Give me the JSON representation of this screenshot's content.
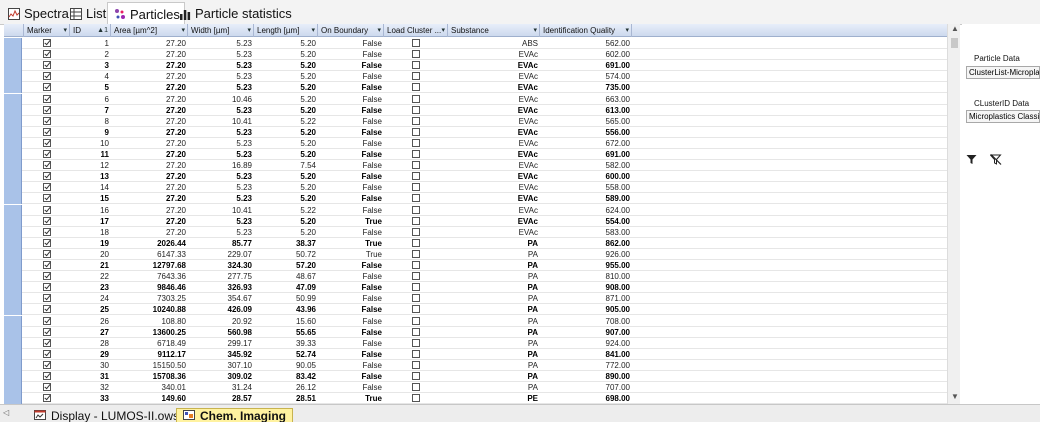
{
  "tabs": [
    {
      "label": "Spectra",
      "icon": "spectra-icon"
    },
    {
      "label": "List",
      "icon": "list-icon"
    },
    {
      "label": "Particles",
      "icon": "particles-icon"
    },
    {
      "label": "Particle statistics",
      "icon": "bar-chart-icon"
    }
  ],
  "active_tab": "Particles",
  "columns": [
    {
      "label": "Marker",
      "sort": ""
    },
    {
      "label": "ID",
      "sort": "▲1"
    },
    {
      "label": "Area [µm^2]",
      "sort": ""
    },
    {
      "label": "Width [µm]",
      "sort": ""
    },
    {
      "label": "Length [µm]",
      "sort": ""
    },
    {
      "label": "On Boundary",
      "sort": ""
    },
    {
      "label": "Load Cluster ...",
      "sort": ""
    },
    {
      "label": "Substance",
      "sort": ""
    },
    {
      "label": "Identification Quality",
      "sort": ""
    }
  ],
  "rows": [
    {
      "id": "1",
      "area": "27.20",
      "width": "5.23",
      "length": "5.20",
      "boundary": "False",
      "substance": "ABS",
      "quality": "562.00",
      "marker": true,
      "load": false,
      "bold": false
    },
    {
      "id": "2",
      "area": "27.20",
      "width": "5.23",
      "length": "5.20",
      "boundary": "False",
      "substance": "EVAc",
      "quality": "602.00",
      "marker": true,
      "load": false,
      "bold": false
    },
    {
      "id": "3",
      "area": "27.20",
      "width": "5.23",
      "length": "5.20",
      "boundary": "False",
      "substance": "EVAc",
      "quality": "691.00",
      "marker": true,
      "load": false,
      "bold": true
    },
    {
      "id": "4",
      "area": "27.20",
      "width": "5.23",
      "length": "5.20",
      "boundary": "False",
      "substance": "EVAc",
      "quality": "574.00",
      "marker": true,
      "load": false,
      "bold": false
    },
    {
      "id": "5",
      "area": "27.20",
      "width": "5.23",
      "length": "5.20",
      "boundary": "False",
      "substance": "EVAc",
      "quality": "735.00",
      "marker": true,
      "load": false,
      "bold": true
    },
    {
      "id": "6",
      "area": "27.20",
      "width": "10.46",
      "length": "5.20",
      "boundary": "False",
      "substance": "EVAc",
      "quality": "663.00",
      "marker": true,
      "load": false,
      "bold": false
    },
    {
      "id": "7",
      "area": "27.20",
      "width": "5.23",
      "length": "5.20",
      "boundary": "False",
      "substance": "EVAc",
      "quality": "613.00",
      "marker": true,
      "load": false,
      "bold": true
    },
    {
      "id": "8",
      "area": "27.20",
      "width": "10.41",
      "length": "5.22",
      "boundary": "False",
      "substance": "EVAc",
      "quality": "565.00",
      "marker": true,
      "load": false,
      "bold": false
    },
    {
      "id": "9",
      "area": "27.20",
      "width": "5.23",
      "length": "5.20",
      "boundary": "False",
      "substance": "EVAc",
      "quality": "556.00",
      "marker": true,
      "load": false,
      "bold": true
    },
    {
      "id": "10",
      "area": "27.20",
      "width": "5.23",
      "length": "5.20",
      "boundary": "False",
      "substance": "EVAc",
      "quality": "672.00",
      "marker": true,
      "load": false,
      "bold": false
    },
    {
      "id": "11",
      "area": "27.20",
      "width": "5.23",
      "length": "5.20",
      "boundary": "False",
      "substance": "EVAc",
      "quality": "691.00",
      "marker": true,
      "load": false,
      "bold": true
    },
    {
      "id": "12",
      "area": "27.20",
      "width": "16.89",
      "length": "7.54",
      "boundary": "False",
      "substance": "EVAc",
      "quality": "582.00",
      "marker": true,
      "load": false,
      "bold": false
    },
    {
      "id": "13",
      "area": "27.20",
      "width": "5.23",
      "length": "5.20",
      "boundary": "False",
      "substance": "EVAc",
      "quality": "600.00",
      "marker": true,
      "load": false,
      "bold": true
    },
    {
      "id": "14",
      "area": "27.20",
      "width": "5.23",
      "length": "5.20",
      "boundary": "False",
      "substance": "EVAc",
      "quality": "558.00",
      "marker": true,
      "load": false,
      "bold": false
    },
    {
      "id": "15",
      "area": "27.20",
      "width": "5.23",
      "length": "5.20",
      "boundary": "False",
      "substance": "EVAc",
      "quality": "589.00",
      "marker": true,
      "load": false,
      "bold": true
    },
    {
      "id": "16",
      "area": "27.20",
      "width": "10.41",
      "length": "5.22",
      "boundary": "False",
      "substance": "EVAc",
      "quality": "624.00",
      "marker": true,
      "load": false,
      "bold": false
    },
    {
      "id": "17",
      "area": "27.20",
      "width": "5.23",
      "length": "5.20",
      "boundary": "True",
      "substance": "EVAc",
      "quality": "554.00",
      "marker": true,
      "load": false,
      "bold": true
    },
    {
      "id": "18",
      "area": "27.20",
      "width": "5.23",
      "length": "5.20",
      "boundary": "False",
      "substance": "EVAc",
      "quality": "583.00",
      "marker": true,
      "load": false,
      "bold": false
    },
    {
      "id": "19",
      "area": "2026.44",
      "width": "85.77",
      "length": "38.37",
      "boundary": "True",
      "substance": "PA",
      "quality": "862.00",
      "marker": true,
      "load": false,
      "bold": true
    },
    {
      "id": "20",
      "area": "6147.33",
      "width": "229.07",
      "length": "50.72",
      "boundary": "True",
      "substance": "PA",
      "quality": "926.00",
      "marker": true,
      "load": false,
      "bold": false
    },
    {
      "id": "21",
      "area": "12797.68",
      "width": "324.30",
      "length": "57.20",
      "boundary": "False",
      "substance": "PA",
      "quality": "955.00",
      "marker": true,
      "load": false,
      "bold": true
    },
    {
      "id": "22",
      "area": "7643.36",
      "width": "277.75",
      "length": "48.67",
      "boundary": "False",
      "substance": "PA",
      "quality": "810.00",
      "marker": true,
      "load": false,
      "bold": false
    },
    {
      "id": "23",
      "area": "9846.46",
      "width": "326.93",
      "length": "47.09",
      "boundary": "False",
      "substance": "PA",
      "quality": "908.00",
      "marker": true,
      "load": false,
      "bold": true
    },
    {
      "id": "24",
      "area": "7303.25",
      "width": "354.67",
      "length": "50.99",
      "boundary": "False",
      "substance": "PA",
      "quality": "871.00",
      "marker": true,
      "load": false,
      "bold": false
    },
    {
      "id": "25",
      "area": "10240.88",
      "width": "426.09",
      "length": "43.96",
      "boundary": "False",
      "substance": "PA",
      "quality": "905.00",
      "marker": true,
      "load": false,
      "bold": true
    },
    {
      "id": "26",
      "area": "108.80",
      "width": "20.92",
      "length": "15.60",
      "boundary": "False",
      "substance": "PA",
      "quality": "708.00",
      "marker": true,
      "load": false,
      "bold": false
    },
    {
      "id": "27",
      "area": "13600.25",
      "width": "560.98",
      "length": "55.65",
      "boundary": "False",
      "substance": "PA",
      "quality": "907.00",
      "marker": true,
      "load": false,
      "bold": true
    },
    {
      "id": "28",
      "area": "6718.49",
      "width": "299.17",
      "length": "39.33",
      "boundary": "False",
      "substance": "PA",
      "quality": "924.00",
      "marker": true,
      "load": false,
      "bold": false
    },
    {
      "id": "29",
      "area": "9112.17",
      "width": "345.92",
      "length": "52.74",
      "boundary": "False",
      "substance": "PA",
      "quality": "841.00",
      "marker": true,
      "load": false,
      "bold": true
    },
    {
      "id": "30",
      "area": "15150.50",
      "width": "307.10",
      "length": "90.05",
      "boundary": "False",
      "substance": "PA",
      "quality": "772.00",
      "marker": true,
      "load": false,
      "bold": false
    },
    {
      "id": "31",
      "area": "15708.36",
      "width": "309.02",
      "length": "83.42",
      "boundary": "False",
      "substance": "PA",
      "quality": "890.00",
      "marker": true,
      "load": false,
      "bold": true
    },
    {
      "id": "32",
      "area": "340.01",
      "width": "31.24",
      "length": "26.12",
      "boundary": "False",
      "substance": "PA",
      "quality": "707.00",
      "marker": true,
      "load": false,
      "bold": false
    },
    {
      "id": "33",
      "area": "149.60",
      "width": "28.57",
      "length": "28.51",
      "boundary": "True",
      "substance": "PE",
      "quality": "698.00",
      "marker": true,
      "load": false,
      "bold": true
    }
  ],
  "side": {
    "particle_label": "Particle Data",
    "particle_value": "ClusterList-Microplastics",
    "cluster_label": "CLusterID Data",
    "cluster_value": "Microplastics Classifier",
    "filter_icon": "filter-icon",
    "clear_filter_icon": "clear-filter-icon"
  },
  "bottom_tabs": [
    {
      "label": "Display - LUMOS-II.ows",
      "icon": "display-icon"
    },
    {
      "label": "Chem. Imaging",
      "icon": "chem-imaging-icon"
    }
  ],
  "colors": {
    "header_bg": "#cdd9ee",
    "row_header_bg": "#a9c2e8",
    "active_bottom_tab": "#fff2a0"
  }
}
